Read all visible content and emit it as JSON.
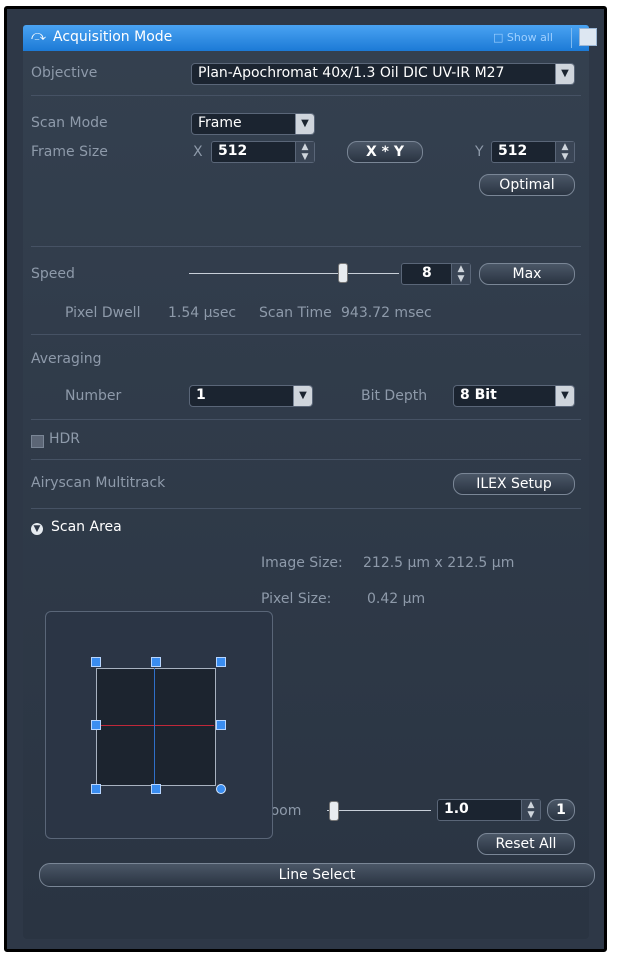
{
  "header": {
    "title": "Acquisition Mode",
    "show_all": "□ Show all"
  },
  "objective": {
    "label": "Objective",
    "value": "Plan-Apochromat 40x/1.3 Oil DIC UV-IR M27"
  },
  "scan_mode": {
    "label": "Scan Mode",
    "value": "Frame"
  },
  "frame_size": {
    "label": "Frame Size",
    "x_label": "X",
    "x_value": "512",
    "xy_button": "X * Y",
    "y_label": "Y",
    "y_value": "512",
    "optimal_button": "Optimal"
  },
  "speed": {
    "label": "Speed",
    "value": "8",
    "max_button": "Max",
    "slider_fraction": 0.73
  },
  "pixel_dwell": {
    "label": "Pixel Dwell",
    "value": "1.54 µsec",
    "scan_time_label": "Scan Time",
    "scan_time_value": "943.72 msec"
  },
  "averaging": {
    "label": "Averaging",
    "number_label": "Number",
    "number_value": "1",
    "bit_depth_label": "Bit Depth",
    "bit_depth_value": "8 Bit"
  },
  "hdr": {
    "label": "HDR",
    "checked": false
  },
  "airyscan": {
    "label": "Airyscan Multitrack",
    "button": "ILEX Setup"
  },
  "scan_area": {
    "title": "Scan Area",
    "image_size_label": "Image Size:",
    "image_size_value": "212.5  µm x  212.5  µm",
    "pixel_size_label": "Pixel Size:",
    "pixel_size_value": "0.42 µm",
    "zoom_label": "Zoom",
    "zoom_value": "1.0",
    "zoom_reset_small": "1",
    "reset_all_button": "Reset All",
    "line_select_button": "Line Select"
  }
}
